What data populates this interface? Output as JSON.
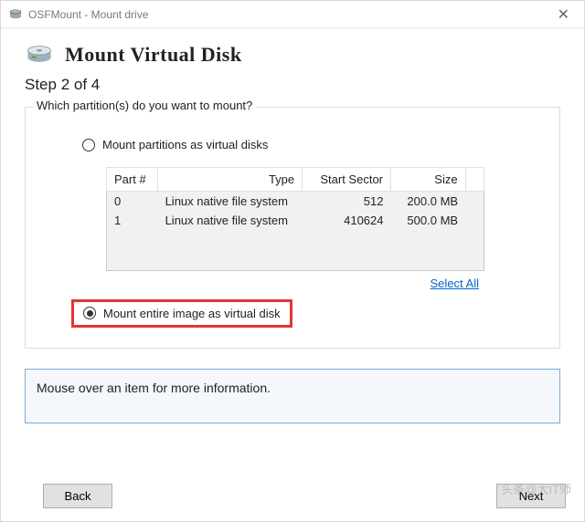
{
  "window": {
    "title": "OSFMount - Mount drive"
  },
  "header": {
    "app_title": "Mount Virtual Disk",
    "step": "Step 2 of 4"
  },
  "group": {
    "legend": "Which partition(s) do you want to mount?",
    "option_partitions": "Mount partitions as virtual disks",
    "option_entire": "Mount entire image as virtual disk",
    "select_all": "Select All"
  },
  "table": {
    "headers": {
      "part": "Part #",
      "type": "Type",
      "start": "Start Sector",
      "size": "Size"
    },
    "rows": [
      {
        "part": "0",
        "type": "Linux native file system",
        "start": "512",
        "size": "200.0 MB"
      },
      {
        "part": "1",
        "type": "Linux native file system",
        "start": "410624",
        "size": "500.0 MB"
      }
    ]
  },
  "info": {
    "text": "Mouse over an item for more information."
  },
  "buttons": {
    "back": "Back",
    "next": "Next"
  },
  "watermark": "头条@大IT师"
}
